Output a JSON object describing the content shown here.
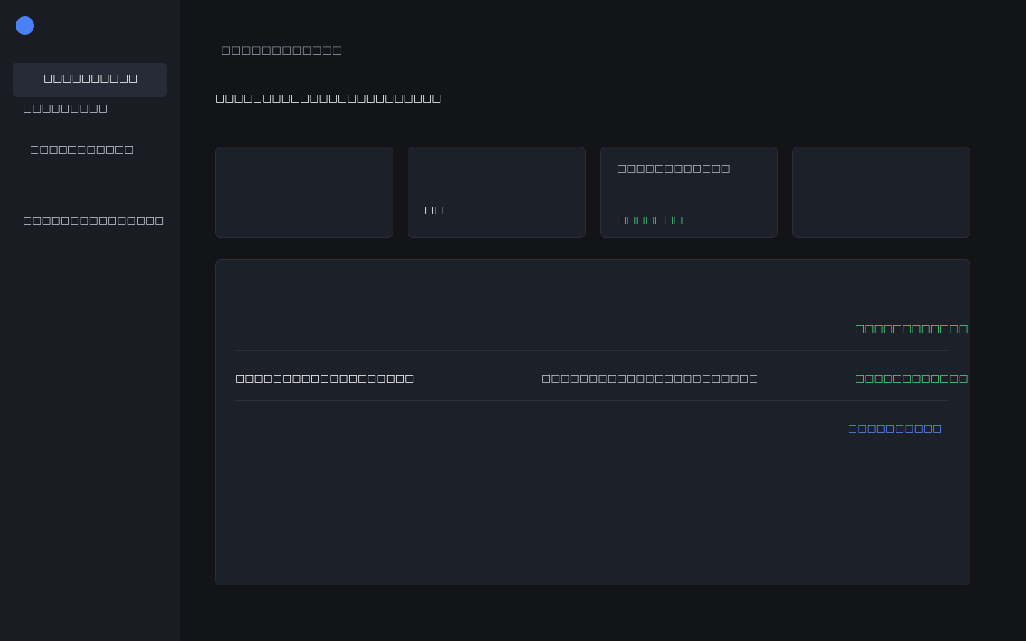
{
  "sidebar": {
    "items": [
      {
        "label": "□□□□□□□□□□"
      },
      {
        "label": "□□□□□□□□□"
      },
      {
        "label": "□□□□□□□□□□□"
      },
      {
        "label": "□□□□□□□□□□□□□□□"
      }
    ]
  },
  "header": {
    "breadcrumb": "□□□□□□□□□□□□",
    "title": "□□□□□□□□□□□□□□□□□□□□□□□□"
  },
  "cards": [
    {
      "value": "□□"
    },
    {
      "label": "□□□□□□□□□□□□",
      "delta": "□□□□□□□"
    }
  ],
  "table": {
    "rows": [
      {
        "status": "□□□□□□□□□□□□"
      },
      {
        "name": "□□□□□□□□□□□□□□□□□□□",
        "detail": "□□□□□□□□□□□□□□□□□□□□□□□",
        "status": "□□□□□□□□□□□□"
      },
      {
        "link": "□□□□□□□□□□"
      }
    ]
  },
  "colors": {
    "accent": "#4a80f5",
    "success": "#4ade80",
    "link": "#5b8ff9",
    "background": "#121418",
    "surface": "#1c2029"
  }
}
